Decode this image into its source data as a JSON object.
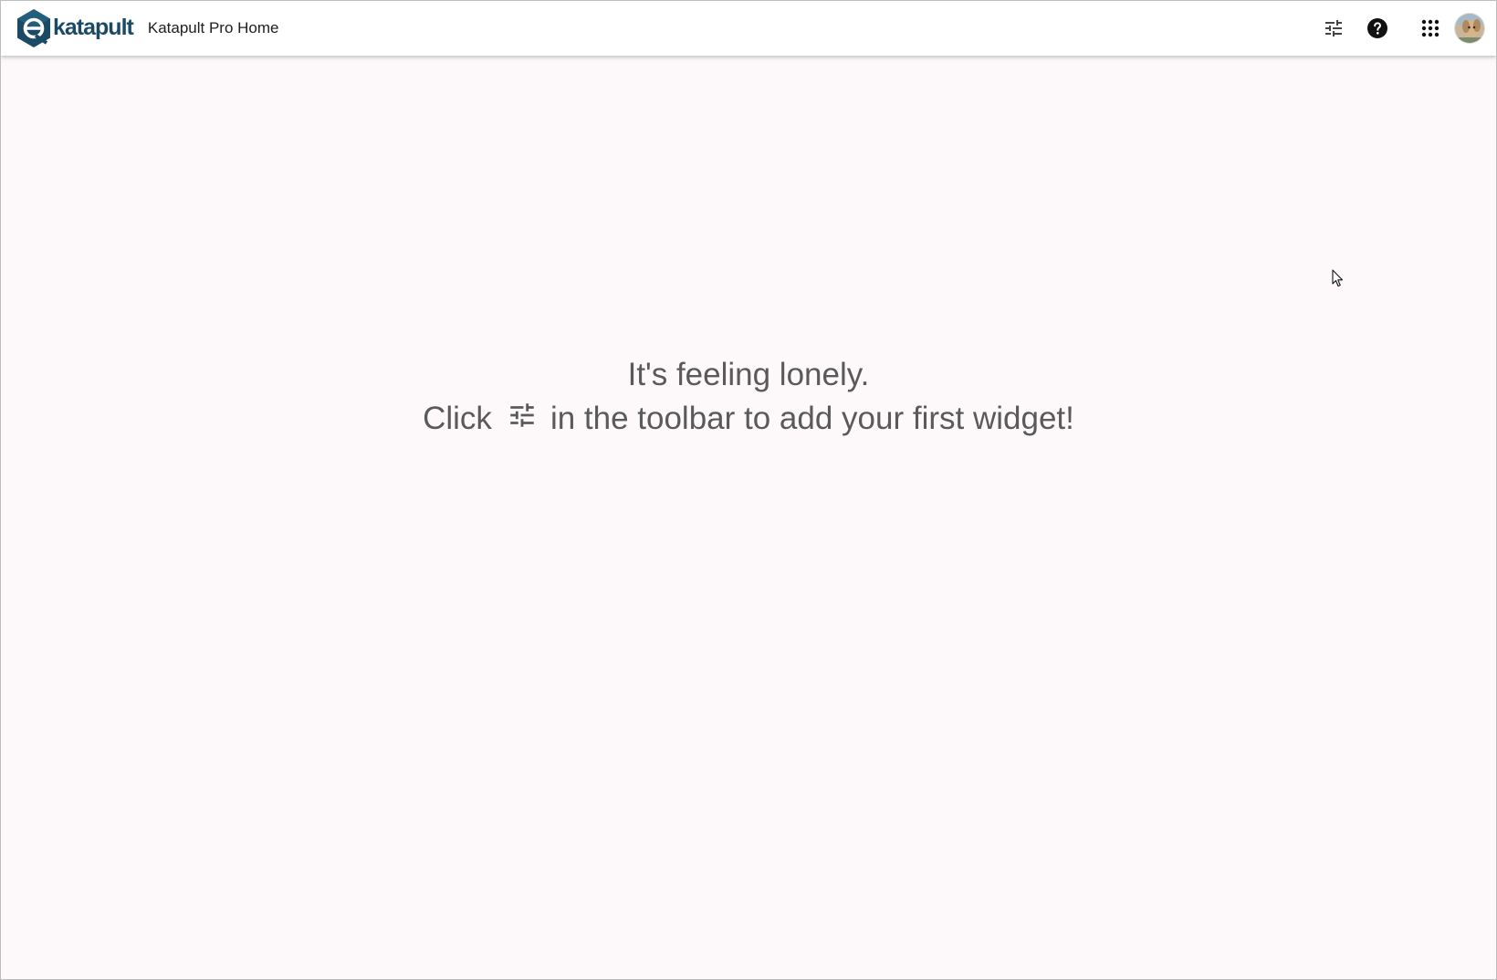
{
  "toolbar": {
    "logo_text": "katapult",
    "app_title": "Katapult Pro Home",
    "icons": {
      "logo": "katapult-logo-icon",
      "customize": "tune-icon",
      "help": "help-icon",
      "apps": "apps-grid-icon",
      "avatar": "user-avatar"
    }
  },
  "empty_state": {
    "line1": "It's feeling lonely.",
    "line2_before": "Click",
    "line2_icon": "tune-icon",
    "line2_after": "in the toolbar to add your first widget!"
  },
  "colors": {
    "brand": "#1b4a66",
    "brand_accent": "#2a6f8f",
    "background": "#fdf9fb",
    "text_muted": "#5a5a5a"
  }
}
